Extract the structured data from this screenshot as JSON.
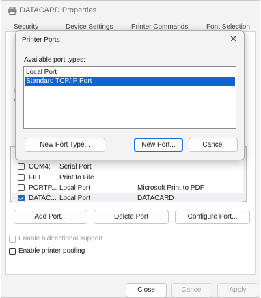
{
  "window": {
    "title": "DATACARD Properties",
    "icon": "printer-icon"
  },
  "tabs": [
    "Security",
    "Device Settings",
    "Printer Commands",
    "Font Selection"
  ],
  "background_fragments": [
    "I",
    "P",
    "c"
  ],
  "ports": [
    {
      "checked": false,
      "port": "COM4:",
      "description": "Serial Port",
      "printer": ""
    },
    {
      "checked": false,
      "port": "FILE:",
      "description": "Print to File",
      "printer": ""
    },
    {
      "checked": false,
      "port": "PORTP...",
      "description": "Local Port",
      "printer": "Microsoft Print to PDF"
    },
    {
      "checked": true,
      "port": "DATAC...",
      "description": "Local Port",
      "printer": "DATACARD"
    }
  ],
  "port_buttons": {
    "add": "Add Port...",
    "delete": "Delete Port",
    "configure": "Configure Port..."
  },
  "options": {
    "bidirectional": "Enable bidirectional support",
    "pooling": "Enable printer pooling"
  },
  "footer": {
    "close": "Close",
    "cancel": "Cancel",
    "apply": "Apply"
  },
  "dialog": {
    "title": "Printer Ports",
    "close_icon": "close-icon",
    "label": "Available port types:",
    "port_types": [
      "Local Port",
      "Standard TCP/IP Port"
    ],
    "selected_index": 1,
    "new_port_type": "New Port Type...",
    "new_port": "New Port...",
    "cancel": "Cancel"
  },
  "colors": {
    "selection": "#0a64d6",
    "primary_border": "#1f6fd6",
    "window_bg": "#f3f3f3"
  }
}
